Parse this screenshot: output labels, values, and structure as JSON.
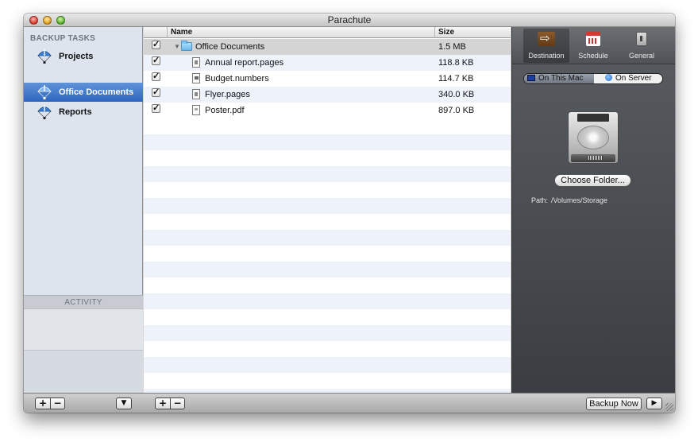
{
  "window": {
    "title": "Parachute"
  },
  "sidebar": {
    "section_title": "BACKUP TASKS",
    "items": [
      {
        "label": "Projects",
        "icon": "parachute-icon",
        "selected": false
      },
      {
        "label": "Office Documents",
        "icon": "parachute-icon",
        "selected": true
      },
      {
        "label": "Reports",
        "icon": "parachute-icon",
        "selected": false
      }
    ],
    "activity_title": "ACTIVITY"
  },
  "file_list": {
    "columns": {
      "name": "Name",
      "size": "Size"
    },
    "rows": [
      {
        "name": "Office Documents",
        "size": "1.5 MB",
        "checked": true,
        "type": "folder",
        "expanded": true
      },
      {
        "name": "Annual report.pages",
        "size": "118.8 KB",
        "checked": true,
        "type": "pages"
      },
      {
        "name": "Budget.numbers",
        "size": "114.7 KB",
        "checked": true,
        "type": "numbers"
      },
      {
        "name": "Flyer.pages",
        "size": "340.0 KB",
        "checked": true,
        "type": "pages"
      },
      {
        "name": "Poster.pdf",
        "size": "897.0 KB",
        "checked": true,
        "type": "pdf"
      }
    ]
  },
  "settings": {
    "tabs": [
      {
        "label": "Destination",
        "icon": "signpost-icon",
        "selected": true
      },
      {
        "label": "Schedule",
        "icon": "calendar-icon",
        "selected": false
      },
      {
        "label": "General",
        "icon": "switch-icon",
        "selected": false
      }
    ],
    "location_toggle": {
      "options": [
        "On This Mac",
        "On Server"
      ],
      "selected": "On This Mac"
    },
    "drive_icon": "hard-drive-icon",
    "choose_folder_label": "Choose Folder...",
    "path_label": "Path:",
    "path_value": "/Volumes/Storage"
  },
  "bottombar": {
    "add_label": "+",
    "remove_label": "−",
    "backup_now_label": "Backup Now"
  },
  "colors": {
    "selection_blue": "#2d66be",
    "row_stripe": "#edf2fb",
    "panel_dark": "#4a4d51"
  }
}
